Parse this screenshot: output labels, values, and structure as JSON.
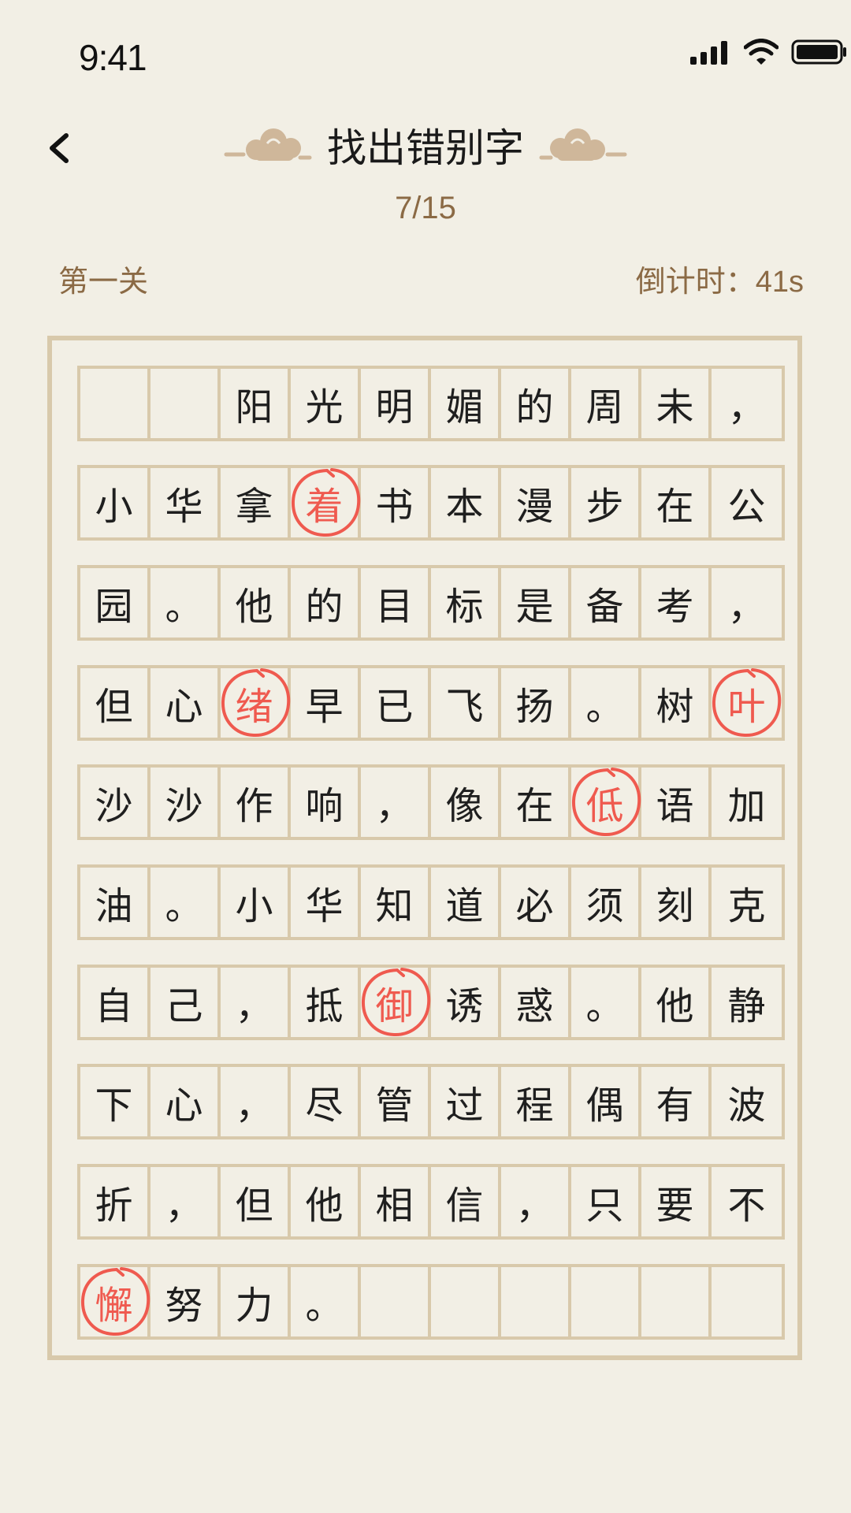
{
  "status": {
    "time": "9:41"
  },
  "header": {
    "title": "找出错别字",
    "progress": "7/15"
  },
  "level": "第一关",
  "timer": {
    "label": "倒计时：",
    "value": "41s"
  },
  "colors": {
    "background": "#f2efe5",
    "grid": "#d8c9ab",
    "accent": "#ef5a4f",
    "label": "#8b6a45"
  },
  "icons": {
    "back": "chevron-left-icon",
    "cloud": "auspicious-cloud-icon"
  },
  "grid": [
    [
      "",
      "",
      "阳",
      "光",
      "明",
      "媚",
      "的",
      "周",
      "未",
      "，"
    ],
    [
      "小",
      "华",
      "拿",
      "着",
      "书",
      "本",
      "漫",
      "步",
      "在",
      "公"
    ],
    [
      "园",
      "。",
      "他",
      "的",
      "目",
      "标",
      "是",
      "备",
      "考",
      "，"
    ],
    [
      "但",
      "心",
      "绪",
      "早",
      "已",
      "飞",
      "扬",
      "。",
      "树",
      "叶"
    ],
    [
      "沙",
      "沙",
      "作",
      "响",
      "，",
      "像",
      "在",
      "低",
      "语",
      "加"
    ],
    [
      "油",
      "。",
      "小",
      "华",
      "知",
      "道",
      "必",
      "须",
      "刻",
      "克"
    ],
    [
      "自",
      "己",
      "，",
      "抵",
      "御",
      "诱",
      "惑",
      "。",
      "他",
      "静"
    ],
    [
      "下",
      "心",
      "，",
      "尽",
      "管",
      "过",
      "程",
      "偶",
      "有",
      "波"
    ],
    [
      "折",
      "，",
      "但",
      "他",
      "相",
      "信",
      "，",
      "只",
      "要",
      "不"
    ],
    [
      "懈",
      "努",
      "力",
      "。",
      "",
      "",
      "",
      "",
      "",
      ""
    ]
  ],
  "marked": [
    [
      1,
      3
    ],
    [
      3,
      2
    ],
    [
      3,
      9
    ],
    [
      4,
      7
    ],
    [
      6,
      4
    ],
    [
      9,
      0
    ]
  ]
}
